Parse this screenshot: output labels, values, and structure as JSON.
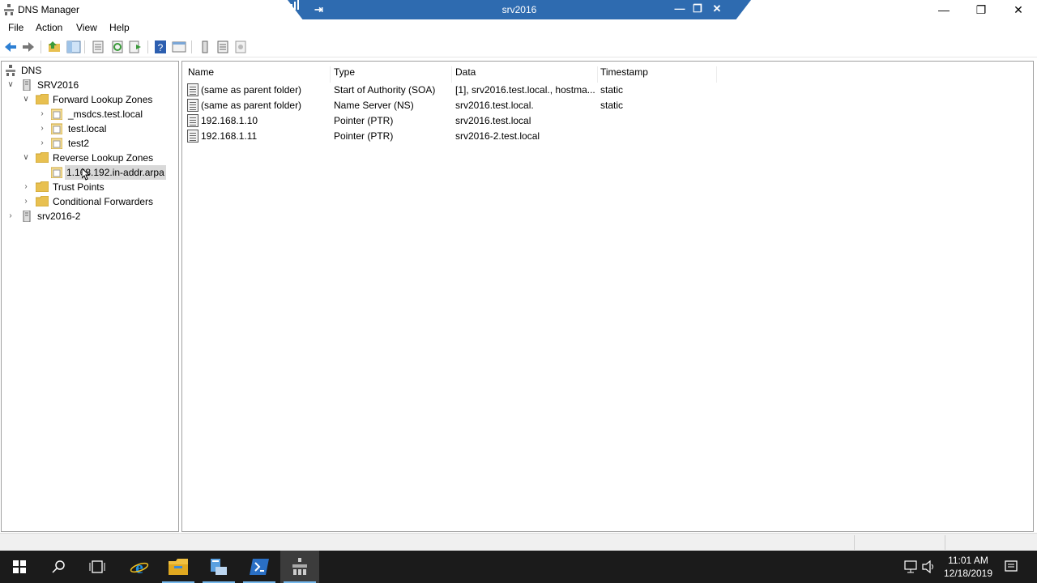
{
  "window": {
    "title": "DNS Manager"
  },
  "rdp": {
    "title": "srv2016"
  },
  "menu": [
    "File",
    "Action",
    "View",
    "Help"
  ],
  "tree": {
    "root": "DNS",
    "server1": "SRV2016",
    "forward": "Forward Lookup Zones",
    "fz1": "_msdcs.test.local",
    "fz2": "test.local",
    "fz3": "test2",
    "reverse": "Reverse Lookup Zones",
    "rz1": "1.168.192.in-addr.arpa",
    "trust": "Trust Points",
    "cond": "Conditional Forwarders",
    "server2": "srv2016-2"
  },
  "list": {
    "headers": [
      "Name",
      "Type",
      "Data",
      "Timestamp"
    ],
    "rows": [
      [
        "(same as parent folder)",
        "Start of Authority (SOA)",
        "[1], srv2016.test.local., hostma...",
        "static"
      ],
      [
        "(same as parent folder)",
        "Name Server (NS)",
        "srv2016.test.local.",
        "static"
      ],
      [
        "192.168.1.10",
        "Pointer (PTR)",
        "srv2016.test.local",
        ""
      ],
      [
        "192.168.1.11",
        "Pointer (PTR)",
        "srv2016-2.test.local",
        ""
      ]
    ]
  },
  "clock": {
    "time": "11:01 AM",
    "date": "12/18/2019"
  },
  "colors": {
    "rdp_bar": "#2e6bb0",
    "taskbar": "#1b1b1b",
    "selection": "#d9d9d9"
  }
}
